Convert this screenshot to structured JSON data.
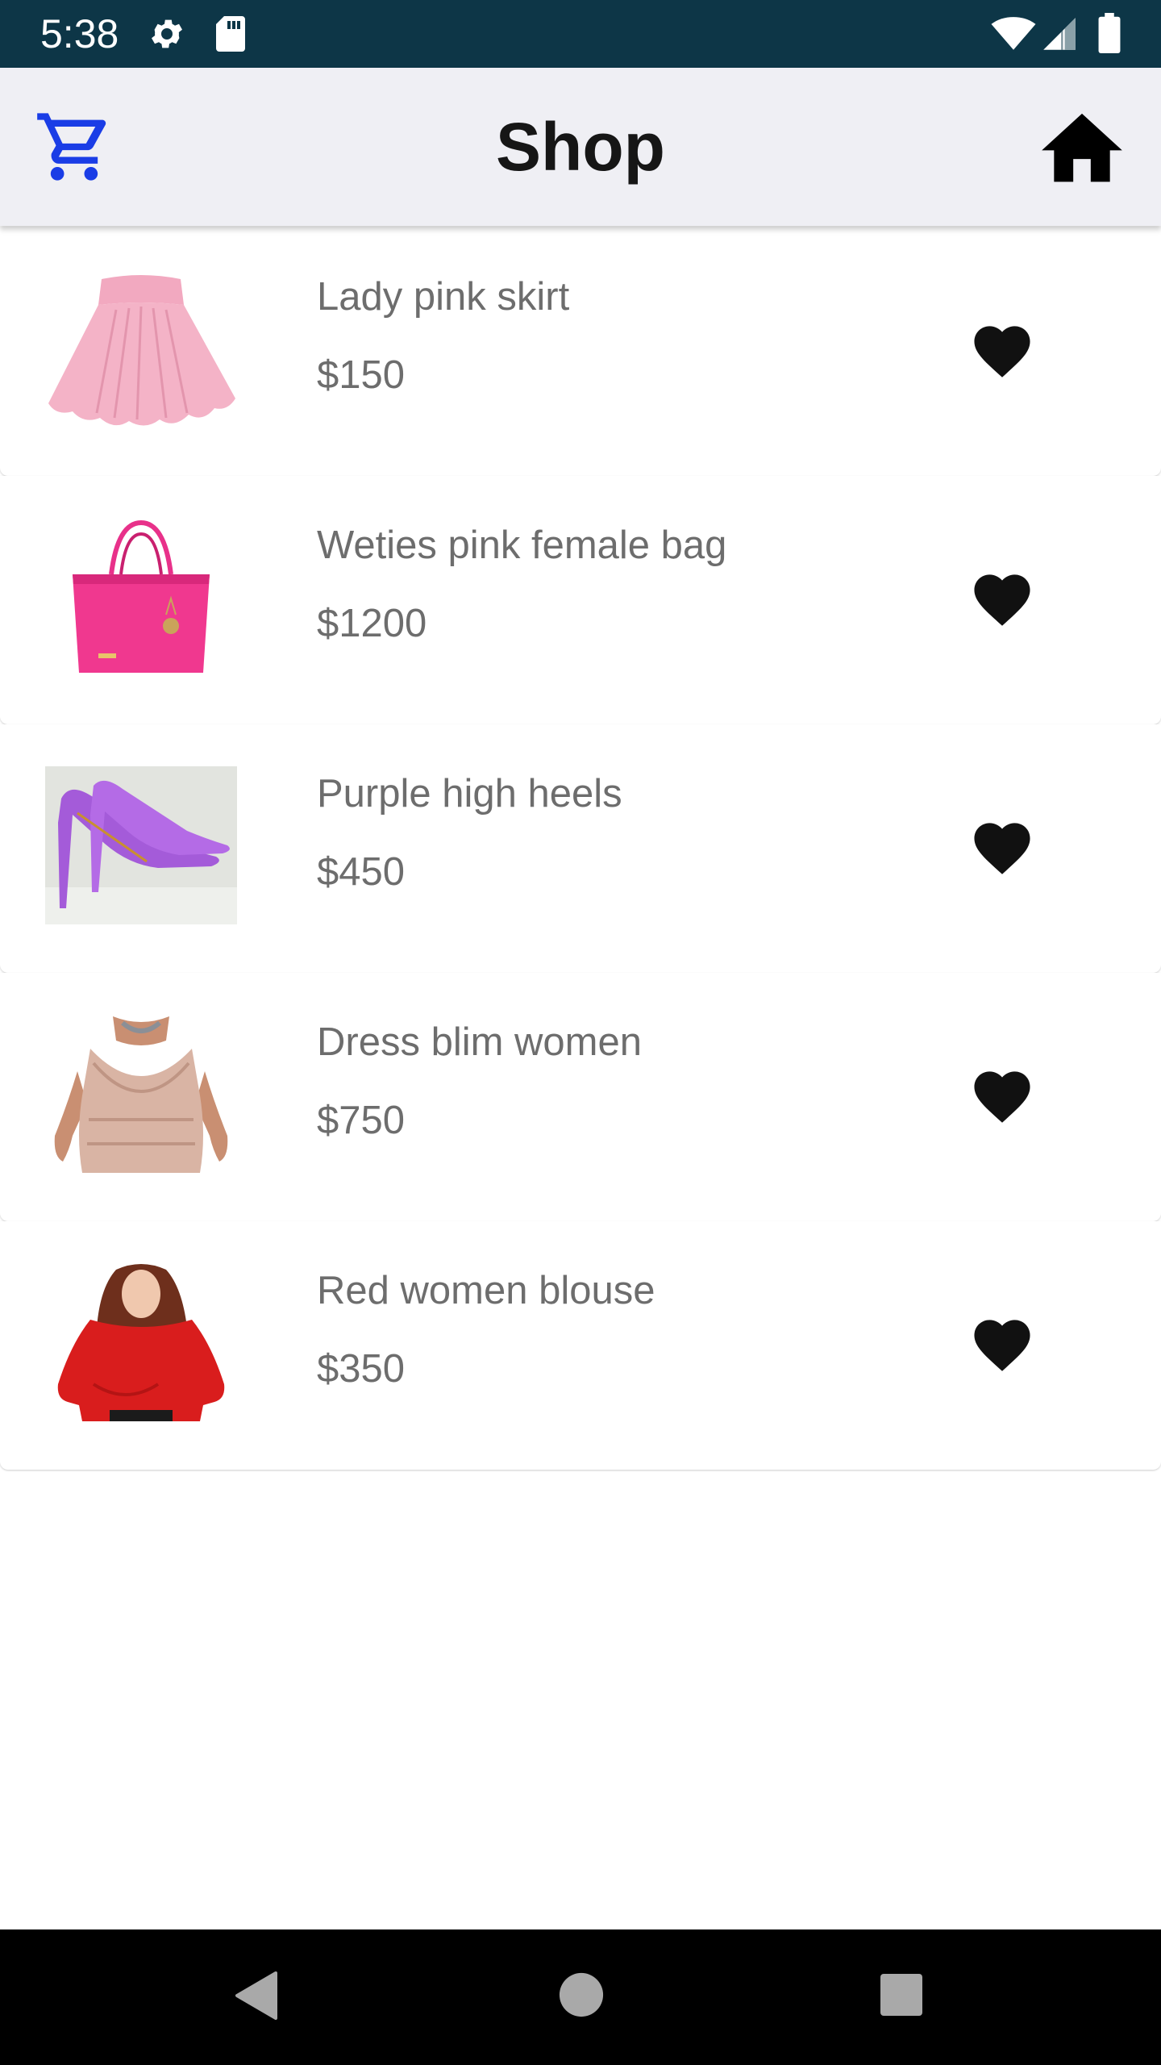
{
  "status_bar": {
    "time": "5:38",
    "icons": [
      "settings-icon",
      "sd-card-icon",
      "wifi-icon",
      "cell-signal-icon",
      "battery-icon"
    ]
  },
  "app_bar": {
    "title": "Shop",
    "left_icon": "shopping-cart-icon",
    "right_icon": "home-icon",
    "accent_color": "#1a3de6"
  },
  "products": [
    {
      "name": "Lady pink skirt",
      "price": "$150",
      "image": "pink-skirt",
      "favorite_icon": "heart-icon"
    },
    {
      "name": "Weties pink female bag",
      "price": "$1200",
      "image": "pink-bag",
      "favorite_icon": "heart-icon"
    },
    {
      "name": "Purple high heels",
      "price": "$450",
      "image": "purple-heels",
      "favorite_icon": "heart-icon"
    },
    {
      "name": "Dress blim women",
      "price": "$750",
      "image": "sequin-dress",
      "favorite_icon": "heart-icon"
    },
    {
      "name": "Red women blouse",
      "price": "$350",
      "image": "red-blouse",
      "favorite_icon": "heart-icon"
    }
  ],
  "nav_bar": {
    "buttons": [
      "back-icon",
      "home-circle-icon",
      "recents-icon"
    ]
  }
}
